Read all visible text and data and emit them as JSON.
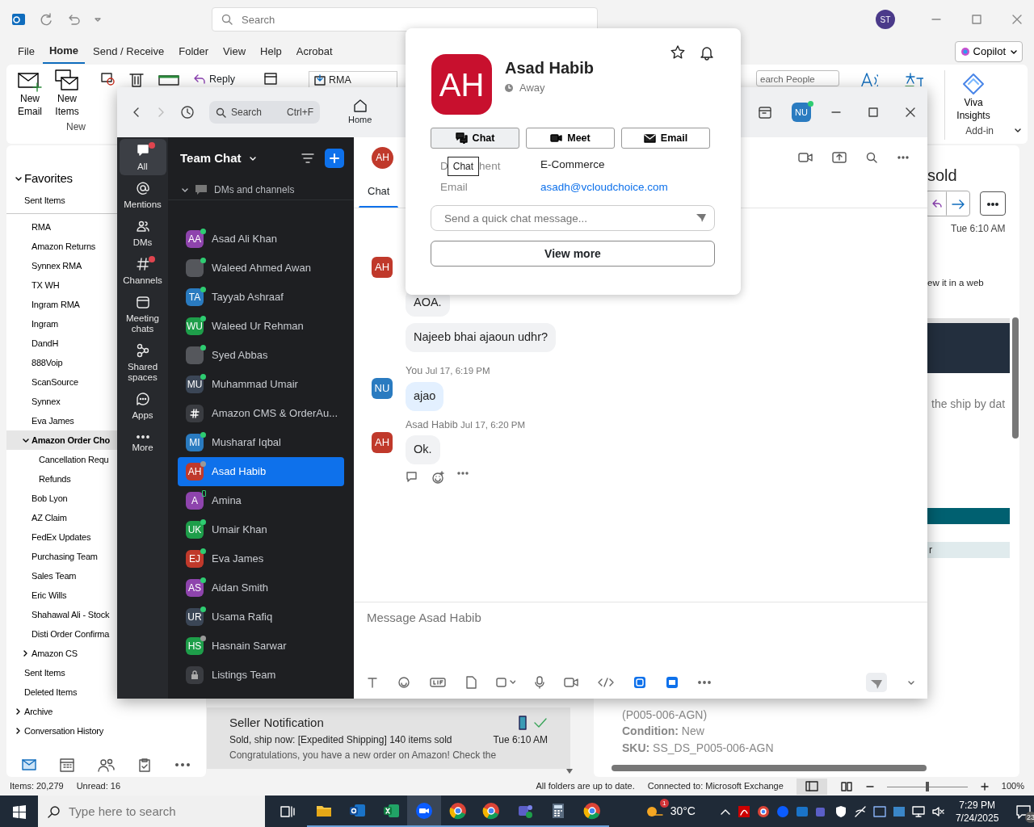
{
  "outlook": {
    "search_placeholder": "Search",
    "account_initials": "ST",
    "menu": [
      {
        "label": "File",
        "selected": false
      },
      {
        "label": "Home",
        "selected": true
      },
      {
        "label": "Send / Receive",
        "selected": false
      },
      {
        "label": "Folder",
        "selected": false
      },
      {
        "label": "View",
        "selected": false
      },
      {
        "label": "Help",
        "selected": false
      },
      {
        "label": "Acrobat",
        "selected": false
      }
    ],
    "copilot": "Copilot",
    "ribbon": {
      "new_email": "New Email",
      "new_items": "New Items",
      "new_group": "New",
      "reply": "Reply",
      "quick_step": "RMA",
      "search_people": "earch People",
      "viva": "Viva Insights",
      "addin_group": "Add-in"
    },
    "favorites": {
      "label": "Favorites",
      "expanded": true,
      "items": [
        {
          "label": "Sent Items",
          "selected": false
        }
      ]
    },
    "inbox_subfolders": [
      {
        "label": "RMA",
        "selected": false
      },
      {
        "label": "Amazon Returns",
        "selected": false
      },
      {
        "label": "Synnex RMA",
        "selected": false
      },
      {
        "label": "TX WH",
        "selected": false
      },
      {
        "label": "Ingram RMA",
        "selected": false
      },
      {
        "label": "Ingram",
        "selected": false
      },
      {
        "label": "DandH",
        "selected": false
      },
      {
        "label": "888Voip",
        "selected": false
      },
      {
        "label": "ScanSource",
        "selected": false
      },
      {
        "label": "Synnex",
        "selected": false
      },
      {
        "label": "Eva James",
        "selected": false
      },
      {
        "label": "Amazon Order Cho",
        "selected": true,
        "expanded": true,
        "children": [
          {
            "label": "Cancellation Requ",
            "selected": false
          },
          {
            "label": "Refunds",
            "selected": false
          }
        ]
      },
      {
        "label": "Bob Lyon",
        "selected": false
      },
      {
        "label": "AZ Claim",
        "selected": false
      },
      {
        "label": "FedEx Updates",
        "selected": false
      },
      {
        "label": "Purchasing Team",
        "selected": false
      },
      {
        "label": "Sales Team",
        "selected": false
      },
      {
        "label": "Eric Wills",
        "selected": false
      },
      {
        "label": "Shahawal Ali - Stock",
        "selected": false
      },
      {
        "label": "Disti Order Confirma",
        "selected": false
      },
      {
        "label": "Amazon CS",
        "selected": false,
        "expanded": false
      }
    ],
    "folders": [
      {
        "label": "Sent Items",
        "selected": false
      },
      {
        "label": "Deleted Items",
        "selected": false
      },
      {
        "label": "Archive",
        "selected": false,
        "expanded": false
      },
      {
        "label": "Conversation History",
        "selected": false,
        "expanded": false
      }
    ],
    "message_list": [
      {
        "sender": "Seller Notification",
        "subject": "Sold, ship now: [Expedited Shipping] 140 items sold",
        "preview": "Congratulations, you have a new order on Amazon! Check the",
        "time": "Tue 6:10 AM",
        "selected": true
      }
    ],
    "reading_pane": {
      "subject": "sold",
      "time": "Tue 6:10 AM",
      "web_note": "ew it in a web",
      "ship_note": "the ship by dat",
      "bar_text": "r",
      "lines": [
        "(P005-006-AGN)",
        "**Condition:** New",
        "**SKU:** SS_DS_P005-006-AGN"
      ]
    },
    "status_bar": {
      "items": "Items: 20,279",
      "unread": "Unread: 16",
      "sync": "All folders are up to date.",
      "connection": "Connected to: Microsoft Exchange",
      "zoom": {
        "level": 0.5
      },
      "zoom_percent": "100%"
    }
  },
  "zoom": {
    "search": {
      "placeholder": "Search",
      "shortcut": "Ctrl+F"
    },
    "home": "Home",
    "user_initials": "NU",
    "nav": [
      {
        "label": "All",
        "selected": true,
        "unread": true
      },
      {
        "label": "Mentions",
        "selected": false,
        "unread": false
      },
      {
        "label": "DMs",
        "selected": false,
        "unread": false
      },
      {
        "label": "Channels",
        "selected": false,
        "unread": true
      },
      {
        "label": "Meeting chats",
        "selected": false,
        "unread": false
      },
      {
        "label": "Shared spaces",
        "selected": false,
        "unread": false
      },
      {
        "label": "Apps",
        "selected": false,
        "unread": false
      },
      {
        "label": "More",
        "selected": false,
        "unread": false
      }
    ],
    "list_title": "Team Chat",
    "section": "DMs and channels",
    "contacts": [
      {
        "name": "Asad Ali Khan",
        "kind": "initials",
        "initials": "AA",
        "color": "#8e44ad",
        "online": true,
        "away": false,
        "mobile": false,
        "selected": false
      },
      {
        "name": "Waleed Ahmed Awan",
        "kind": "photo",
        "online": true,
        "away": false,
        "mobile": false,
        "selected": false
      },
      {
        "name": "Tayyab Ashraaf",
        "kind": "initials",
        "initials": "TA",
        "color": "#2a7bc0",
        "online": true,
        "away": false,
        "mobile": false,
        "selected": false
      },
      {
        "name": "Waleed Ur Rehman",
        "kind": "initials",
        "initials": "WU",
        "color": "#1e9e4a",
        "online": true,
        "away": false,
        "mobile": false,
        "selected": false
      },
      {
        "name": "Syed Abbas",
        "kind": "photo",
        "online": true,
        "away": false,
        "mobile": false,
        "selected": false
      },
      {
        "name": "Muhammad Umair",
        "kind": "initials",
        "initials": "MU",
        "color": "#3b4656",
        "online": true,
        "away": false,
        "mobile": false,
        "selected": false
      },
      {
        "name": "Amazon CMS & OrderAu...",
        "kind": "channel",
        "online": false,
        "away": false,
        "mobile": false,
        "selected": false
      },
      {
        "name": "Musharaf Iqbal",
        "kind": "initials",
        "initials": "MI",
        "color": "#2a7bc0",
        "online": true,
        "away": false,
        "mobile": false,
        "selected": false
      },
      {
        "name": "Asad Habib",
        "kind": "initials",
        "initials": "AH",
        "color": "#c0392b",
        "online": false,
        "away": true,
        "mobile": false,
        "selected": true
      },
      {
        "name": "Amina",
        "kind": "initials",
        "initials": "A",
        "color": "#8e44ad",
        "online": false,
        "away": false,
        "mobile": true,
        "selected": false
      },
      {
        "name": "Umair Khan",
        "kind": "initials",
        "initials": "UK",
        "color": "#1e9e4a",
        "online": true,
        "away": false,
        "mobile": false,
        "selected": false
      },
      {
        "name": "Eva James",
        "kind": "initials",
        "initials": "EJ",
        "color": "#c0392b",
        "online": true,
        "away": false,
        "mobile": false,
        "selected": false
      },
      {
        "name": "Aidan Smith",
        "kind": "initials",
        "initials": "AS",
        "color": "#8e44ad",
        "online": true,
        "away": false,
        "mobile": false,
        "selected": false
      },
      {
        "name": "Usama Rafiq",
        "kind": "initials",
        "initials": "UR",
        "color": "#3b4656",
        "online": true,
        "away": false,
        "mobile": false,
        "selected": false
      },
      {
        "name": "Hasnain Sarwar",
        "kind": "initials",
        "initials": "HS",
        "color": "#1e9e4a",
        "online": false,
        "away": true,
        "mobile": false,
        "selected": false
      },
      {
        "name": "Listings Team",
        "kind": "private",
        "online": false,
        "away": false,
        "mobile": false,
        "selected": false
      }
    ],
    "chat": {
      "initials": "AH",
      "color": "#c0392b",
      "tabs": [
        {
          "label": "Chat",
          "selected": true
        }
      ],
      "messages": [
        {
          "initials": "AH",
          "color": "#c0392b",
          "mine": false,
          "bubbles": [
            "AOA.",
            "Najeeb bhai ajaoun udhr?"
          ]
        },
        {
          "author": "You",
          "time": "Jul 17, 6:19 PM",
          "initials": "NU",
          "color": "#2a7bc0",
          "mine": true,
          "bubbles": [
            "ajao"
          ]
        },
        {
          "author": "Asad Habib",
          "time": "Jul 17, 6:20 PM",
          "initials": "AH",
          "color": "#c0392b",
          "mine": false,
          "bubbles": [
            "Ok."
          ]
        }
      ],
      "composer_placeholder": "Message Asad Habib"
    }
  },
  "profile_card": {
    "initials": "AH",
    "name": "Asad Habib",
    "status": "Away",
    "actions": [
      "Chat",
      "Meet",
      "Email"
    ],
    "tooltip": "Chat",
    "department": {
      "label_start": "D",
      "label_end": "hent",
      "value": "E-Commerce"
    },
    "email": {
      "label": "Email",
      "value": "asadh@vcloudchoice.com"
    },
    "quick_message_placeholder": "Send a quick chat message...",
    "view_more": "View more"
  },
  "taskbar": {
    "search_placeholder": "Type here to search",
    "apps": [
      {
        "kind": "files",
        "selected": false
      },
      {
        "kind": "outlook",
        "selected": false
      },
      {
        "kind": "excel",
        "selected": false
      },
      {
        "kind": "zoom",
        "selected": true
      },
      {
        "kind": "chrome",
        "selected": false
      },
      {
        "kind": "chrome",
        "selected": false
      },
      {
        "kind": "teams",
        "selected": false
      },
      {
        "kind": "calculator",
        "selected": false
      },
      {
        "kind": "chrome",
        "selected": false
      }
    ],
    "weather": "30°C",
    "weather_badge": "1",
    "time": "7:29 PM",
    "date": "7/24/2025",
    "notifications": "23"
  }
}
